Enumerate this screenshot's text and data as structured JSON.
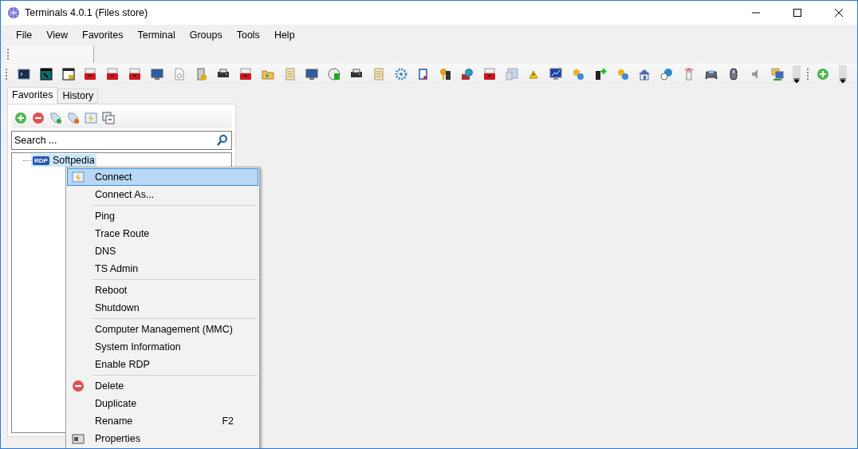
{
  "window": {
    "title": "Terminals 4.0.1 (Files store)"
  },
  "menu_bar": [
    "File",
    "View",
    "Favorites",
    "Terminal",
    "Groups",
    "Tools",
    "Help"
  ],
  "side_tabs": [
    {
      "label": "Favorites",
      "selected": true
    },
    {
      "label": "History",
      "selected": false
    }
  ],
  "search": {
    "placeholder": "Search ..."
  },
  "tree": [
    {
      "badge": "RDP",
      "label": "Softpedia",
      "selected": true
    }
  ],
  "context_menu": [
    {
      "kind": "item",
      "label": "Connect",
      "selected": true
    },
    {
      "kind": "item",
      "label": "Connect As...",
      "selected": false
    },
    {
      "kind": "separator"
    },
    {
      "kind": "item",
      "label": "Ping",
      "selected": false
    },
    {
      "kind": "item",
      "label": "Trace Route",
      "selected": false
    },
    {
      "kind": "item",
      "label": "DNS",
      "selected": false
    },
    {
      "kind": "item",
      "label": "TS Admin",
      "selected": false
    },
    {
      "kind": "separator"
    },
    {
      "kind": "item",
      "label": "Reboot",
      "selected": false
    },
    {
      "kind": "item",
      "label": "Shutdown",
      "selected": false
    },
    {
      "kind": "separator"
    },
    {
      "kind": "item",
      "label": "Computer Management (MMC)",
      "selected": false
    },
    {
      "kind": "item",
      "label": "System Information",
      "selected": false
    },
    {
      "kind": "item",
      "label": "Enable RDP",
      "selected": false
    },
    {
      "kind": "separator"
    },
    {
      "kind": "item",
      "label": "Delete",
      "selected": false
    },
    {
      "kind": "item",
      "label": "Duplicate",
      "selected": false
    },
    {
      "kind": "item",
      "label": "Rename",
      "shortcut": "F2",
      "selected": false
    },
    {
      "kind": "item",
      "label": "Properties",
      "selected": false
    }
  ]
}
